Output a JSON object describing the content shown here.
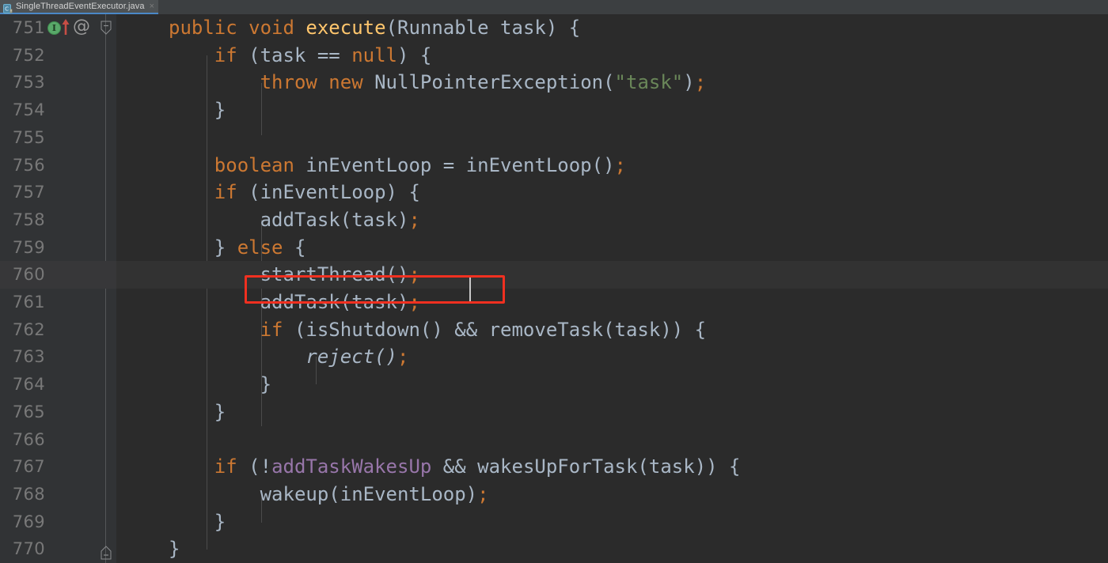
{
  "window": {
    "theme_bg": "#2b2b2b",
    "gutter_bg": "#313335"
  },
  "tabbar": {
    "active_tab": {
      "label": "SingleThreadEventExecutor.java",
      "icon": "java-class-icon",
      "close_glyph": "×",
      "underline_color": "#4a88c7"
    }
  },
  "gutter": {
    "markers": {
      "inspection_glyph": "I",
      "override_glyph": "@",
      "arrow_icon": "red-up-arrow-icon",
      "fold_icon": "fold-region-icon"
    }
  },
  "annotation": {
    "type": "red-rectangle-highlight",
    "color": "#f03020",
    "target_text": "startThread();",
    "target_line": 760
  },
  "editor": {
    "caret_line": 760,
    "colors": {
      "keyword": "#cc7832",
      "method": "#ffc66d",
      "string": "#6a8759",
      "field": "#9876aa",
      "default": "#a9b7c6",
      "linenumber": "#787878"
    },
    "lines": [
      {
        "num": "751",
        "indent": 1,
        "tokens": [
          {
            "t": "public",
            "c": "t-kw"
          },
          {
            "t": " ",
            "c": "t-def"
          },
          {
            "t": "void",
            "c": "t-kw"
          },
          {
            "t": " ",
            "c": "t-def"
          },
          {
            "t": "execute",
            "c": "t-meth"
          },
          {
            "t": "(Runnable task) {",
            "c": "t-def"
          }
        ]
      },
      {
        "num": "752",
        "indent": 2,
        "tokens": [
          {
            "t": "if",
            "c": "t-kw"
          },
          {
            "t": " (task == ",
            "c": "t-def"
          },
          {
            "t": "null",
            "c": "t-kw"
          },
          {
            "t": ") {",
            "c": "t-def"
          }
        ]
      },
      {
        "num": "753",
        "indent": 3,
        "tokens": [
          {
            "t": "throw",
            "c": "t-kw"
          },
          {
            "t": " ",
            "c": "t-def"
          },
          {
            "t": "new",
            "c": "t-kw"
          },
          {
            "t": " NullPointerException(",
            "c": "t-def"
          },
          {
            "t": "\"task\"",
            "c": "t-str"
          },
          {
            "t": ")",
            "c": "t-def"
          },
          {
            "t": ";",
            "c": "t-semi"
          }
        ]
      },
      {
        "num": "754",
        "indent": 2,
        "tokens": [
          {
            "t": "}",
            "c": "t-def"
          }
        ]
      },
      {
        "num": "755",
        "indent": 0,
        "tokens": []
      },
      {
        "num": "756",
        "indent": 2,
        "tokens": [
          {
            "t": "boolean",
            "c": "t-kw"
          },
          {
            "t": " inEventLoop = inEventLoop()",
            "c": "t-def"
          },
          {
            "t": ";",
            "c": "t-semi"
          }
        ]
      },
      {
        "num": "757",
        "indent": 2,
        "tokens": [
          {
            "t": "if",
            "c": "t-kw"
          },
          {
            "t": " (inEventLoop) {",
            "c": "t-def"
          }
        ]
      },
      {
        "num": "758",
        "indent": 3,
        "tokens": [
          {
            "t": "addTask(task)",
            "c": "t-def"
          },
          {
            "t": ";",
            "c": "t-semi"
          }
        ]
      },
      {
        "num": "759",
        "indent": 2,
        "tokens": [
          {
            "t": "} ",
            "c": "t-def"
          },
          {
            "t": "else",
            "c": "t-kw"
          },
          {
            "t": " {",
            "c": "t-def"
          }
        ]
      },
      {
        "num": "760",
        "indent": 3,
        "tokens": [
          {
            "t": "startThread()",
            "c": "t-def"
          },
          {
            "t": ";",
            "c": "t-semi"
          }
        ]
      },
      {
        "num": "761",
        "indent": 3,
        "tokens": [
          {
            "t": "addTask(task)",
            "c": "t-def"
          },
          {
            "t": ";",
            "c": "t-semi"
          }
        ]
      },
      {
        "num": "762",
        "indent": 3,
        "tokens": [
          {
            "t": "if",
            "c": "t-kw"
          },
          {
            "t": " (isShutdown() && removeTask(task)) {",
            "c": "t-def"
          }
        ]
      },
      {
        "num": "763",
        "indent": 4,
        "tokens": [
          {
            "t": "reject()",
            "c": "t-stat"
          },
          {
            "t": ";",
            "c": "t-semi"
          }
        ]
      },
      {
        "num": "764",
        "indent": 3,
        "tokens": [
          {
            "t": "}",
            "c": "t-def"
          }
        ]
      },
      {
        "num": "765",
        "indent": 2,
        "tokens": [
          {
            "t": "}",
            "c": "t-def"
          }
        ]
      },
      {
        "num": "766",
        "indent": 0,
        "tokens": []
      },
      {
        "num": "767",
        "indent": 2,
        "tokens": [
          {
            "t": "if",
            "c": "t-kw"
          },
          {
            "t": " (!",
            "c": "t-def"
          },
          {
            "t": "addTaskWakesUp",
            "c": "t-field"
          },
          {
            "t": " && wakesUpForTask(task)) {",
            "c": "t-def"
          }
        ]
      },
      {
        "num": "768",
        "indent": 3,
        "tokens": [
          {
            "t": "wakeup(inEventLoop)",
            "c": "t-def"
          },
          {
            "t": ";",
            "c": "t-semi"
          }
        ]
      },
      {
        "num": "769",
        "indent": 2,
        "tokens": [
          {
            "t": "}",
            "c": "t-def"
          }
        ]
      },
      {
        "num": "770",
        "indent": 1,
        "tokens": [
          {
            "t": "}",
            "c": "t-def"
          }
        ]
      }
    ]
  }
}
